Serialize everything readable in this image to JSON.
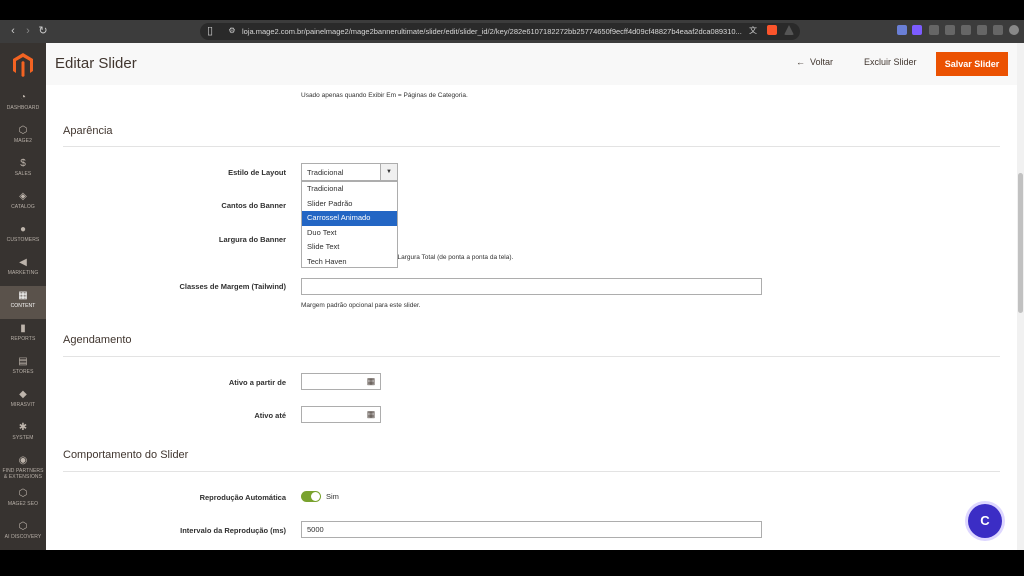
{
  "browser": {
    "url": "loja.mage2.com.br/painelmage2/mage2bannerultimate/slider/edit/slider_id/2/key/282e6107182272bb25774650f9ecff4d09cf48827b4eaaf2dca089310...",
    "icons": [
      "back-icon",
      "forward-icon",
      "reload-icon",
      "bookmark-icon",
      "site-info-icon",
      "translate-icon",
      "brave-shield-icon",
      "alert-icon",
      "extension-icon",
      "profile-icon"
    ]
  },
  "sidebar": {
    "items": [
      {
        "label": "DASHBOARD",
        "icon": "dashboard-icon",
        "glyph": "◔"
      },
      {
        "label": "MAGE2",
        "icon": "hexagon-icon",
        "glyph": "⬡"
      },
      {
        "label": "SALES",
        "icon": "dollar-icon",
        "glyph": "$"
      },
      {
        "label": "CATALOG",
        "icon": "box-icon",
        "glyph": "◈"
      },
      {
        "label": "CUSTOMERS",
        "icon": "person-icon",
        "glyph": "●"
      },
      {
        "label": "MARKETING",
        "icon": "megaphone-icon",
        "glyph": "◀"
      },
      {
        "label": "CONTENT",
        "icon": "layout-icon",
        "glyph": "▦"
      },
      {
        "label": "REPORTS",
        "icon": "bar-chart-icon",
        "glyph": "▮"
      },
      {
        "label": "STORES",
        "icon": "store-icon",
        "glyph": "▤"
      },
      {
        "label": "MIRASVIT",
        "icon": "diamond-icon",
        "glyph": "◆"
      },
      {
        "label": "SYSTEM",
        "icon": "gear-icon",
        "glyph": "✱"
      },
      {
        "label": "FIND PARTNERS & EXTENSIONS",
        "icon": "puzzle-icon",
        "glyph": "◉"
      },
      {
        "label": "MAGE2 SEO",
        "icon": "hexagon-icon",
        "glyph": "⬡"
      },
      {
        "label": "AI DISCOVERY",
        "icon": "hexagon-icon",
        "glyph": "⬡"
      }
    ],
    "active_index": 6
  },
  "header": {
    "title": "Editar Slider",
    "back_label": "Voltar",
    "delete_label": "Excluir Slider",
    "save_label": "Salvar Slider"
  },
  "top_note": "Usado apenas quando Exibir Em = Páginas de Categoria.",
  "appearance": {
    "title": "Aparência",
    "layout_label": "Estilo de Layout",
    "layout_value": "Tradicional",
    "layout_options": [
      "Tradicional",
      "Slider Padrão",
      "Carrossel Animado",
      "Duo Text",
      "Slide Text",
      "Tech Haven"
    ],
    "highlighted_option": 2,
    "corners_label": "Cantos do Banner",
    "width_label": "Largura do Banner",
    "width_note": "tema) ou Largura Total (de ponta a ponta da tela).",
    "margin_label": "Classes de Margem (Tailwind)",
    "margin_value": "",
    "margin_note": "Margem padrão opcional para este slider."
  },
  "schedule": {
    "title": "Agendamento",
    "from_label": "Ativo a partir de",
    "from_value": "",
    "to_label": "Ativo até",
    "to_value": ""
  },
  "behavior": {
    "title": "Comportamento do Slider",
    "autoplay_label": "Reprodução Automática",
    "autoplay_on": true,
    "autoplay_state": "Sim",
    "interval_label": "Intervalo da Reprodução (ms)",
    "interval_value": "5000"
  },
  "chat": {
    "label": "C"
  },
  "colors": {
    "accent": "#eb5202",
    "sidebar": "#373330",
    "highlight": "#2366c4",
    "toggle_on": "#79a22e",
    "chat": "#3b2dc5"
  }
}
